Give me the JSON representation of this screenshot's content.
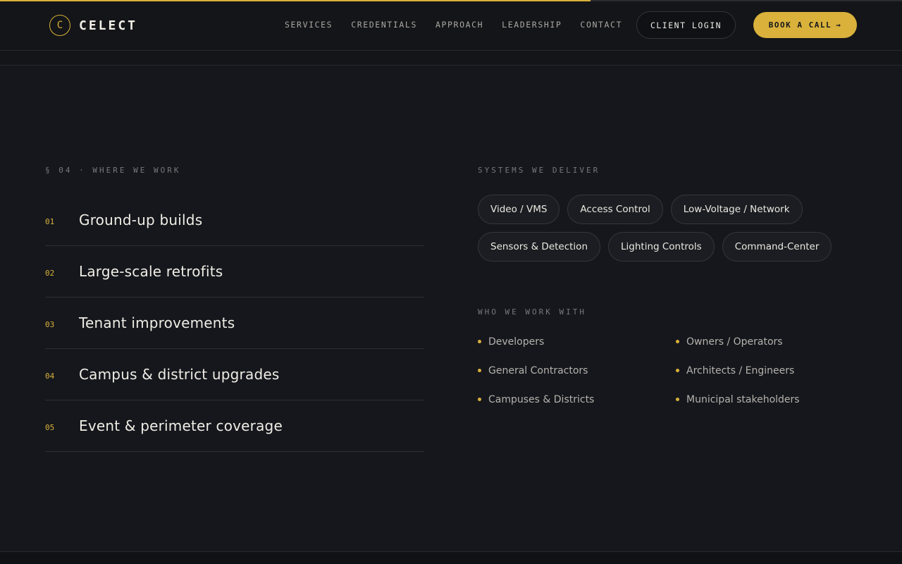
{
  "progress": {
    "fraction": 0.655,
    "color": "#d9b13b"
  },
  "header": {
    "logo_mark": "C",
    "logo_text": "CELECT",
    "nav": [
      "SERVICES",
      "CREDENTIALS",
      "APPROACH",
      "LEADERSHIP",
      "CONTACT"
    ],
    "login_label": "CLIENT LOGIN",
    "book_label": "BOOK A CALL",
    "book_arrow": "→"
  },
  "where": {
    "eyebrow": "§ 04 · WHERE WE WORK",
    "items": [
      {
        "num": "01",
        "label": "Ground-up builds"
      },
      {
        "num": "02",
        "label": "Large-scale retrofits"
      },
      {
        "num": "03",
        "label": "Tenant improvements"
      },
      {
        "num": "04",
        "label": "Campus & district upgrades"
      },
      {
        "num": "05",
        "label": "Event & perimeter coverage"
      }
    ]
  },
  "systems": {
    "eyebrow": "SYSTEMS WE DELIVER",
    "rows": [
      [
        "Video / VMS",
        "Access Control",
        "Low-Voltage / Network"
      ],
      [
        "Sensors & Detection",
        "Lighting Controls",
        "Command-Center"
      ]
    ]
  },
  "who": {
    "eyebrow": "WHO WE WORK WITH",
    "items": [
      "Developers",
      "Owners / Operators",
      "General Contractors",
      "Architects / Engineers",
      "Campuses & Districts",
      "Municipal stakeholders"
    ]
  },
  "colors": {
    "accent": "#d9b13b",
    "background": "#15171c"
  }
}
